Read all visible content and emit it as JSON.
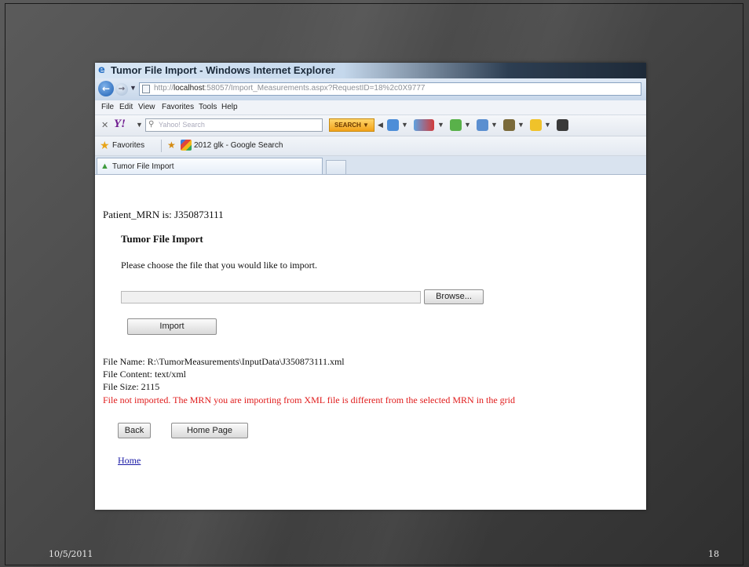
{
  "window": {
    "title": "Tumor File Import - Windows Internet Explorer",
    "url_prefix": "http://",
    "url_host": "localhost",
    "url_rest": ":58057/Import_Measurements.aspx?RequestID=18%2c0X9777"
  },
  "menu": [
    "File",
    "Edit",
    "View",
    "Favorites",
    "Tools",
    "Help"
  ],
  "search_toolbar": {
    "logo": "Y!",
    "placeholder": "Yahoo! Search",
    "search_label": "SEARCH"
  },
  "favorites_bar": {
    "label": "Favorites",
    "link": "2012 glk - Google Search"
  },
  "tab": {
    "label": "Tumor File Import"
  },
  "page": {
    "mrn_line": "Patient_MRN is: J350873111",
    "heading": "Tumor File Import",
    "instruction": "Please choose the file that you would like to import.",
    "browse_label": "Browse...",
    "import_label": "Import",
    "file_name": "File Name: R:\\TumorMeasurements\\InputData\\J350873111.xml",
    "file_content": "File Content: text/xml",
    "file_size": "File Size: 2115",
    "error": "File not imported. The MRN you are importing from XML file is different from the selected MRN in the grid",
    "back_label": "Back",
    "home_page_label": "Home Page",
    "home_link": "Home"
  },
  "slide": {
    "date": "10/5/2011",
    "number": "18"
  },
  "colors": {
    "error": "#e01b1b",
    "link": "#1a1aa6",
    "slide_background": "#4a4a4a"
  }
}
